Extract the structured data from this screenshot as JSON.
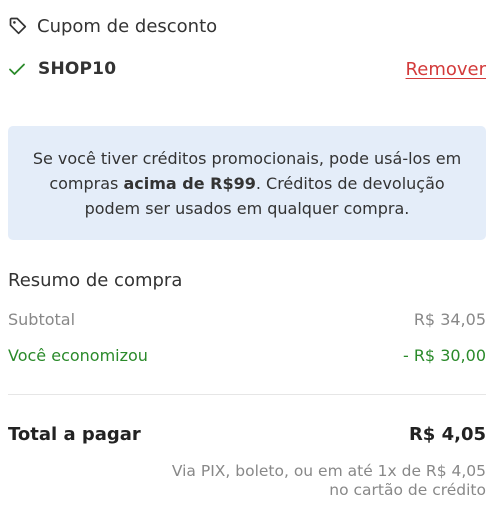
{
  "coupon": {
    "title": "Cupom de desconto",
    "code": "SHOP10",
    "remove_label": "Remover"
  },
  "info": {
    "text_before": "Se você tiver créditos promocionais, pode usá-los em compras ",
    "text_bold": "acima de R$99",
    "text_after": ". Créditos de devolução podem ser usados em qualquer compra."
  },
  "summary": {
    "title": "Resumo de compra",
    "subtotal_label": "Subtotal",
    "subtotal_value": "R$ 34,05",
    "savings_label": "Você economizou",
    "savings_value": "- R$ 30,00",
    "total_label": "Total a pagar",
    "total_value": "R$ 4,05",
    "payment_line1": "Via PIX, boleto, ou em até 1x de R$ 4,05",
    "payment_line2": "no cartão de crédito"
  },
  "icons": {
    "coupon": "tag-icon",
    "applied": "check-icon"
  },
  "colors": {
    "remove_link": "#d33a3a",
    "savings": "#2a8a2a",
    "info_background": "#e4edf9",
    "muted_text": "#888888"
  }
}
